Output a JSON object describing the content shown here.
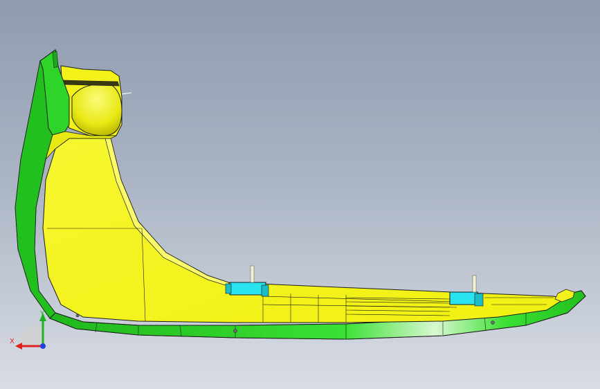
{
  "colors": {
    "background_top": "#8f9bb0",
    "background_bottom": "#d9dde4",
    "part_green": "#2fd42a",
    "part_green_dark": "#1aa818",
    "part_yellow": "#f2f21a",
    "part_yellow_light": "#fbfb6a",
    "part_yellow_dark": "#c9c90a",
    "clip_cyan": "#29e3ee",
    "edge": "#1a1a1a",
    "axis_x": "#e02020",
    "axis_y": "#20b020",
    "axis_z": "#2040e0"
  },
  "triad": {
    "x_label": "X",
    "y_label": "Y",
    "icon": "coordinate-triad-icon"
  }
}
